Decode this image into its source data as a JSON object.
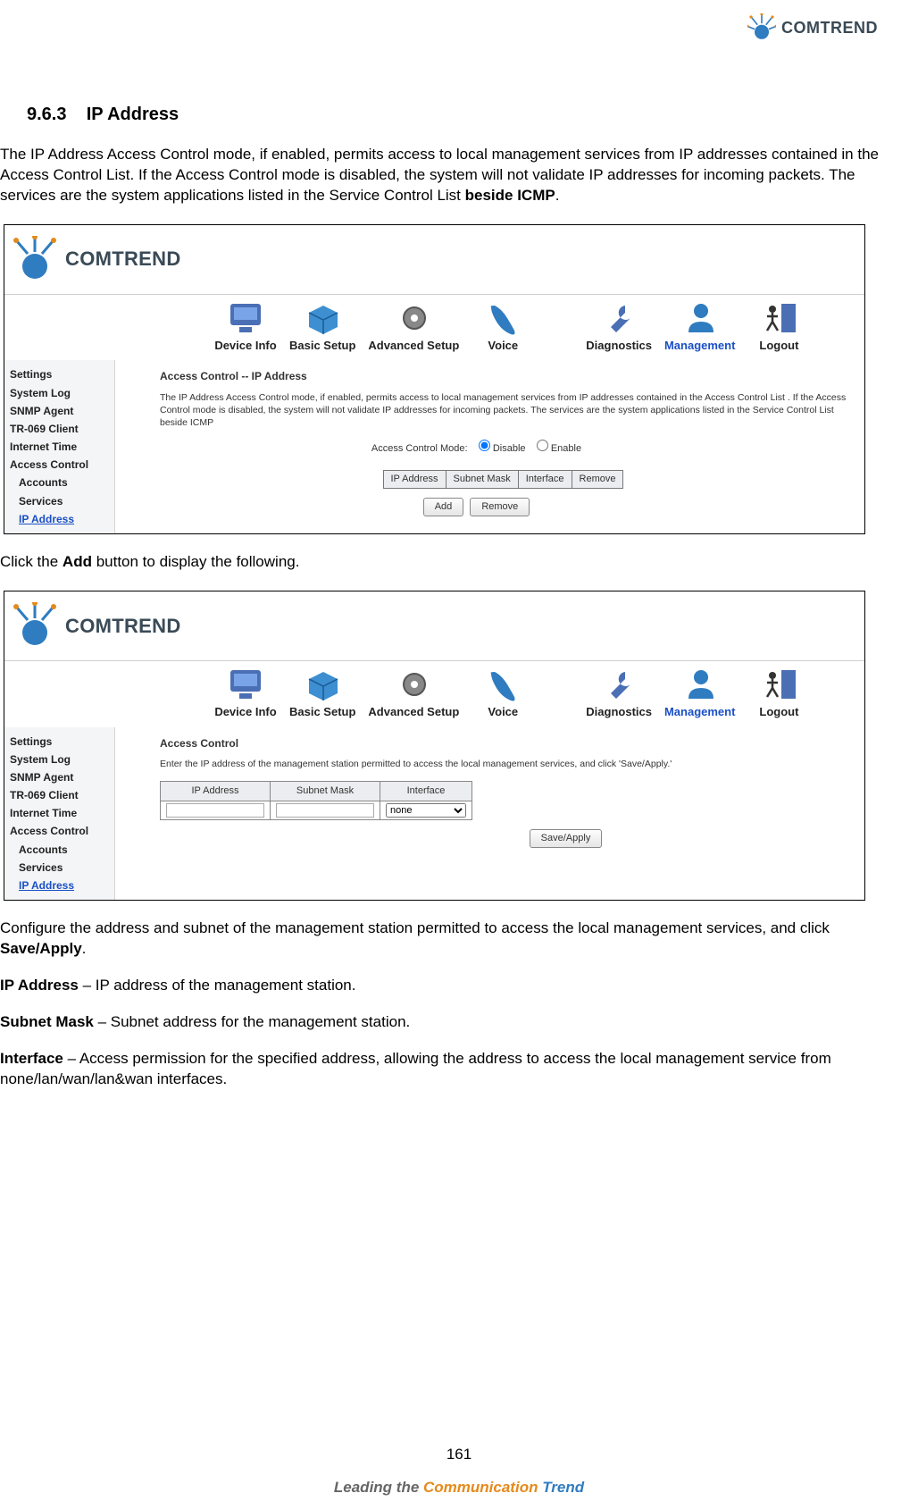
{
  "brand": "COMTREND",
  "section_number": "9.6.3",
  "section_title": "IP Address",
  "intro_a": "The IP Address Access Control mode, if enabled, permits access to local management services from IP addresses contained in the Access Control List. If the Access Control mode is disabled, the system will not validate IP addresses for incoming packets. The services are the system applications listed in the Service Control List ",
  "intro_b": "beside ICMP",
  "intro_c": ".",
  "click_a": "Click the ",
  "click_b": "Add",
  "click_c": " button to display the following.",
  "config_a": "Configure the address and subnet of the management station permitted to access the local management services, and click ",
  "config_b": "Save/Apply",
  "config_c": ".",
  "defs": {
    "ip_label": "IP Address",
    "ip_text": " – IP address of the management station.",
    "sm_label": "Subnet Mask",
    "sm_text": " – Subnet address for the management station.",
    "if_label": "Interface",
    "if_text": " – Access permission for the specified address, allowing the address to access the local management service from none/lan/wan/lan&wan interfaces."
  },
  "nav": {
    "device_info": "Device Info",
    "basic_setup": "Basic Setup",
    "advanced_setup": "Advanced Setup",
    "voice": "Voice",
    "diagnostics": "Diagnostics",
    "management": "Management",
    "logout": "Logout"
  },
  "sidebar": {
    "settings": "Settings",
    "system_log": "System Log",
    "snmp_agent": "SNMP Agent",
    "tr069": "TR-069 Client",
    "internet_time": "Internet Time",
    "access_control": "Access Control",
    "accounts": "Accounts",
    "services": "Services",
    "ip_address": "IP Address"
  },
  "shot1": {
    "title": "Access Control -- IP Address",
    "desc": "The IP Address Access Control mode, if enabled, permits access to local management services from IP addresses contained in the Access Control List . If the Access Control mode is disabled, the system will not validate IP addresses for incoming packets. The services are the system applications listed in the Service Control List beside ICMP",
    "mode_label": "Access Control Mode:",
    "disable": "Disable",
    "enable": "Enable",
    "cols": {
      "ip": "IP Address",
      "sm": "Subnet Mask",
      "if": "Interface",
      "rm": "Remove"
    },
    "btn_add": "Add",
    "btn_remove": "Remove"
  },
  "shot2": {
    "title": "Access Control",
    "desc": "Enter the IP address of the management station permitted to access the local management services, and click 'Save/Apply.'",
    "cols": {
      "ip": "IP Address",
      "sm": "Subnet Mask",
      "if": "Interface"
    },
    "if_option": "none",
    "btn_save": "Save/Apply"
  },
  "page_number": "161",
  "tagline": {
    "a": "Leading the ",
    "b": "Communication",
    "c": " Trend"
  }
}
